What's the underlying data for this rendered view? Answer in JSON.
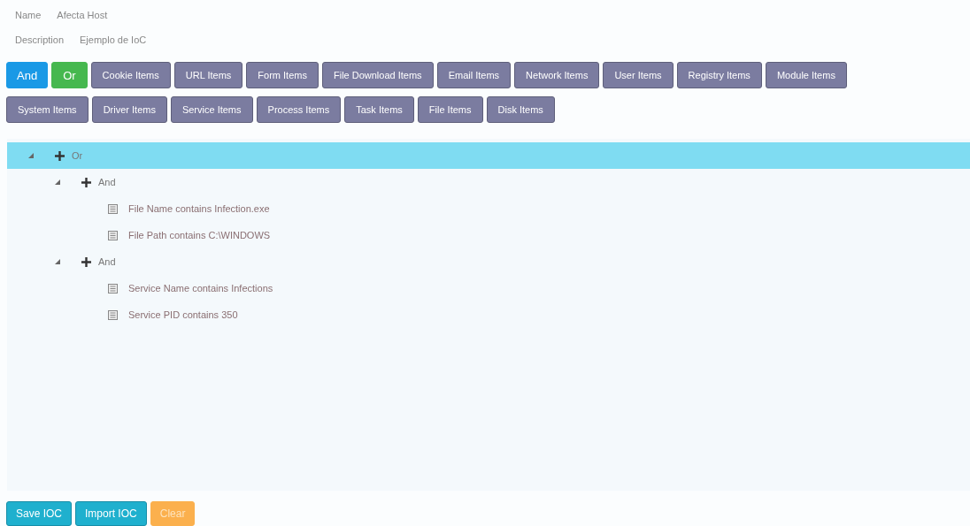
{
  "fields": [
    {
      "label": "Name",
      "value": "Afecta Host"
    },
    {
      "label": "Description",
      "value": "Ejemplo de IoC"
    }
  ],
  "toolbar_rows": [
    [
      {
        "label": "And",
        "kind": "and"
      },
      {
        "label": "Or",
        "kind": "or"
      },
      {
        "label": "Cookie Items",
        "kind": "item"
      },
      {
        "label": "URL Items",
        "kind": "item"
      },
      {
        "label": "Form Items",
        "kind": "item"
      },
      {
        "label": "File Download Items",
        "kind": "item"
      },
      {
        "label": "Email Items",
        "kind": "item"
      },
      {
        "label": "Network Items",
        "kind": "item"
      },
      {
        "label": "User Items",
        "kind": "item"
      },
      {
        "label": "Registry Items",
        "kind": "item"
      },
      {
        "label": "Module Items",
        "kind": "item"
      }
    ],
    [
      {
        "label": "System Items",
        "kind": "item"
      },
      {
        "label": "Driver Items",
        "kind": "item"
      },
      {
        "label": "Service Items",
        "kind": "item"
      },
      {
        "label": "Process Items",
        "kind": "item"
      },
      {
        "label": "Task Items",
        "kind": "item"
      },
      {
        "label": "File Items",
        "kind": "item"
      },
      {
        "label": "Disk Items",
        "kind": "item"
      }
    ]
  ],
  "tree": [
    {
      "kind": "group",
      "label": "Or",
      "expanded": true,
      "selected": true,
      "children": [
        {
          "kind": "group",
          "label": "And",
          "expanded": true,
          "selected": false,
          "children": [
            {
              "kind": "condition",
              "label": "File Name contains Infection.exe",
              "selected": false
            },
            {
              "kind": "condition",
              "label": "File Path contains C:\\WINDOWS",
              "selected": false
            }
          ]
        },
        {
          "kind": "group",
          "label": "And",
          "expanded": true,
          "selected": false,
          "children": [
            {
              "kind": "condition",
              "label": "Service Name contains Infections",
              "selected": false
            },
            {
              "kind": "condition",
              "label": "Service PID contains 350",
              "selected": false
            }
          ]
        }
      ]
    }
  ],
  "actions": [
    {
      "label": "Save IOC",
      "kind": "primary"
    },
    {
      "label": "Import IOC",
      "kind": "primary"
    },
    {
      "label": "Clear",
      "kind": "warning"
    }
  ]
}
